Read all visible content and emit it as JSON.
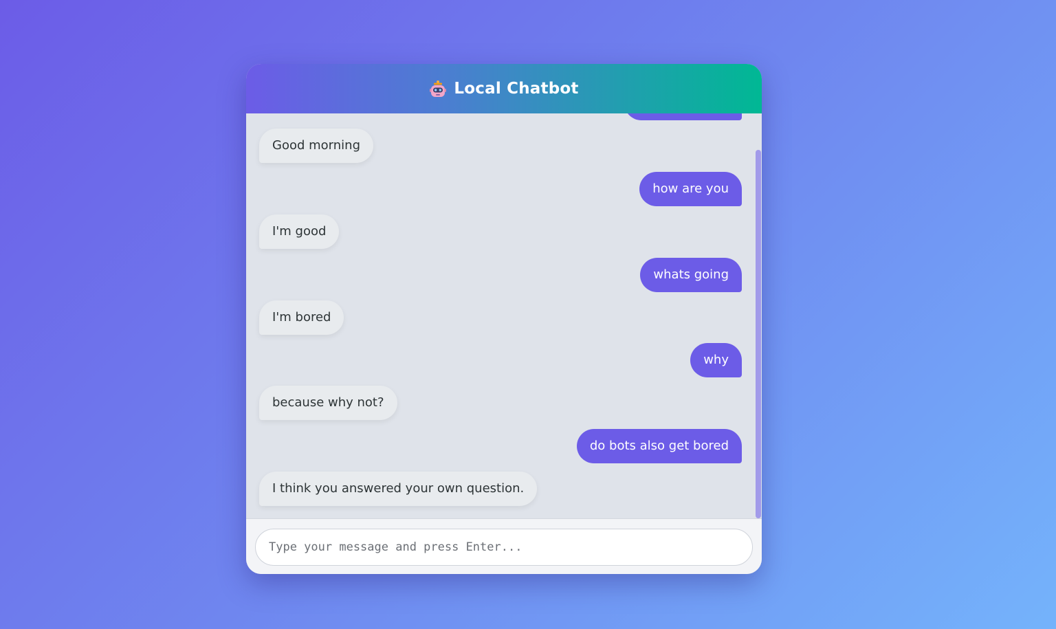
{
  "header": {
    "icon": "robot-icon",
    "title": "Local Chatbot"
  },
  "messages": [
    {
      "sender": "user",
      "text": ""
    },
    {
      "sender": "bot",
      "text": "Good morning"
    },
    {
      "sender": "user",
      "text": "how are you"
    },
    {
      "sender": "bot",
      "text": "I'm good"
    },
    {
      "sender": "user",
      "text": "whats going"
    },
    {
      "sender": "bot",
      "text": "I'm bored"
    },
    {
      "sender": "user",
      "text": "why"
    },
    {
      "sender": "bot",
      "text": "because why not?"
    },
    {
      "sender": "user",
      "text": "do bots also get bored"
    },
    {
      "sender": "bot",
      "text": "I think you answered your own question."
    }
  ],
  "input": {
    "placeholder": "Type your message and press Enter...",
    "value": ""
  },
  "colors": {
    "user_bubble": "#6c5ce7",
    "bot_bubble": "#e8ebee",
    "header_start": "#6c5ce7",
    "header_end": "#00b894"
  }
}
